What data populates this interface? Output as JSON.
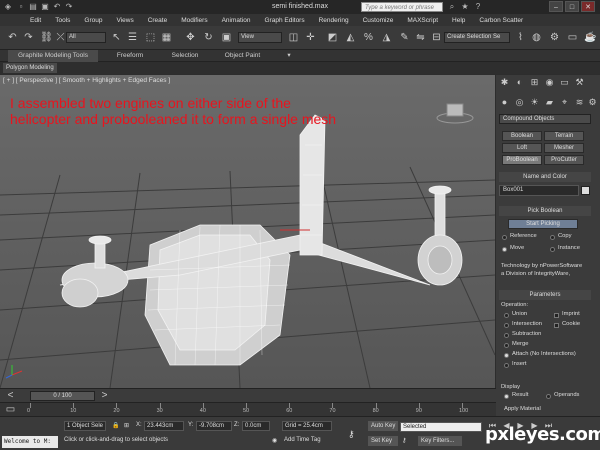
{
  "window": {
    "title": "semi finished.max",
    "search_placeholder": "Type a keyword or phrase"
  },
  "menu": [
    "Edit",
    "Tools",
    "Group",
    "Views",
    "Create",
    "Modifiers",
    "Animation",
    "Graph Editors",
    "Rendering",
    "Customize",
    "MAXScript",
    "Help",
    "Carbon Scatter"
  ],
  "toolbar": {
    "selection_filter": "All",
    "ref_coord": "View",
    "named_selection": "Create Selection Se"
  },
  "ribbon": {
    "tabs": [
      "Graphite Modeling Tools",
      "Freeform",
      "Selection",
      "Object Paint"
    ],
    "subtab": "Polygon Modeling"
  },
  "viewport": {
    "label": "[ + ] [ Perspective ] [ Smooth + Highlights + Edged Faces ]",
    "annotation": "I assembled two engines on either side of the helicopter and probooleaned it to form a single mesh",
    "annotation_color": "#e8141e"
  },
  "command_panel": {
    "category": "Compound Objects",
    "object_type_buttons": [
      "Boolean",
      "Terrain",
      "Loft",
      "Mesher",
      "ProBoolean",
      "ProCutter"
    ],
    "name_color_header": "Name and Color",
    "object_name": "Box001",
    "pick_boolean_header": "Pick Boolean",
    "start_picking": "Start Picking",
    "pick_options": [
      {
        "label": "Reference",
        "selected": false
      },
      {
        "label": "Copy",
        "selected": false
      },
      {
        "label": "Move",
        "selected": true
      },
      {
        "label": "Instance",
        "selected": false
      }
    ],
    "tech_text_1": "Technology by nPowerSoftware",
    "tech_text_2": "a Division of IntegrityWare,",
    "parameters_header": "Parameters",
    "operation_label": "Operation:",
    "operations": [
      {
        "label": "Union",
        "selected": false
      },
      {
        "label": "Intersection",
        "selected": false
      },
      {
        "label": "Subtraction",
        "selected": false
      },
      {
        "label": "Merge",
        "selected": false
      },
      {
        "label": "Attach (No Intersections)",
        "selected": true
      },
      {
        "label": "Insert",
        "selected": false
      }
    ],
    "imprint": "Imprint",
    "cookie": "Cookie",
    "display_label": "Display",
    "display_result": "Result",
    "display_operands": "Operands",
    "apply_material": "Apply Material"
  },
  "timeline": {
    "frame": "0 / 100",
    "ticks": [
      "0",
      "10",
      "20",
      "30",
      "40",
      "50",
      "60",
      "70",
      "80",
      "90",
      "100"
    ]
  },
  "status": {
    "welcome": "Welcome to M:",
    "objects_selected": "1 Object Sele",
    "prompt": "Click or click-and-drag to select objects",
    "x_label": "X:",
    "x_value": "23.443cm",
    "y_label": "Y:",
    "y_value": "-9.708cm",
    "z_label": "Z:",
    "z_value": "0.0cm",
    "grid": "Grid = 25.4cm",
    "add_time_tag": "Add Time Tag",
    "auto_key": "Auto Key",
    "set_key": "Set Key",
    "key_mode": "Selected",
    "key_filters": "Key Filters..."
  },
  "watermark": "pxleyes.com"
}
